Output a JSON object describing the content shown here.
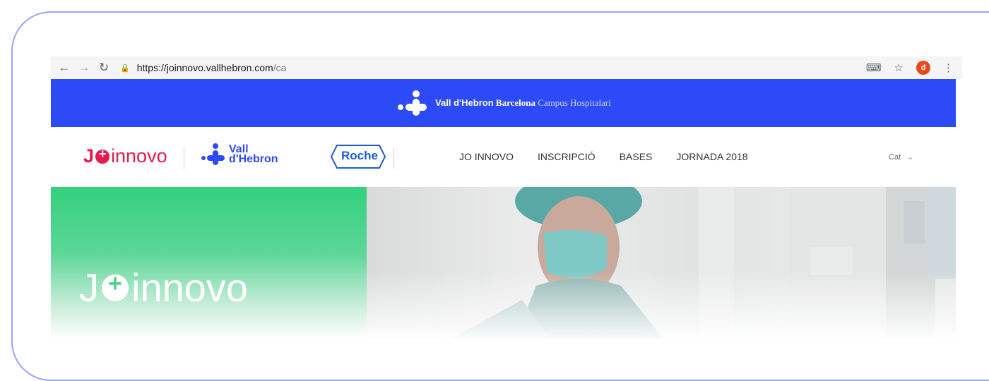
{
  "browser": {
    "url_host": "https://joinnovo.vallhebron.com",
    "url_path": "/ca",
    "avatar_letter": "d"
  },
  "banner": {
    "brand_bold": "Vall d'Hebron",
    "brand_city": "Barcelona",
    "brand_rest": "Campus Hospitalari",
    "background": "#2d4af7"
  },
  "header": {
    "jo_prefix": "J",
    "jo_suffix": "innovo",
    "vh_line1": "Vall",
    "vh_line2": "d'Hebron",
    "roche": "Roche",
    "menu": [
      "JO INNOVO",
      "INSCRIPCIÓ",
      "BASES",
      "JORNADA 2018"
    ],
    "lang": "Cat"
  },
  "hero": {
    "logo_prefix": "J",
    "logo_suffix": "innovo"
  },
  "colors": {
    "brand_red": "#e5194c",
    "brand_blue": "#2d4af7",
    "hero_green": "#33d07d"
  }
}
